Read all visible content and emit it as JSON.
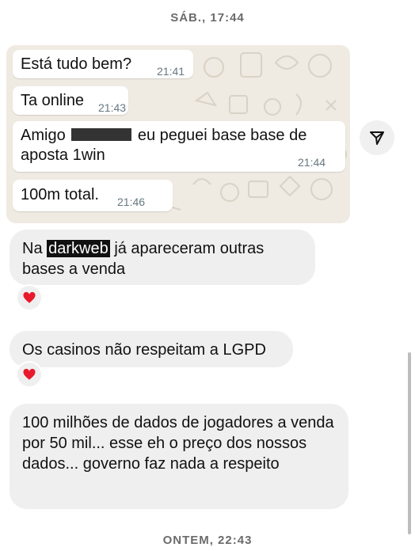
{
  "date_separators": {
    "top": "SÁB., 17:44",
    "bottom": "ONTEM, 22:43"
  },
  "shared_screenshot": {
    "messages": [
      {
        "text": "Está tudo bem?",
        "time": "21:41"
      },
      {
        "text": "Ta online",
        "time": "21:43"
      },
      {
        "text_before_redaction": "Amigo",
        "text_after_redaction": "eu peguei base base de aposta 1win",
        "time": "21:44"
      },
      {
        "text": "100m total.",
        "time": "21:46"
      }
    ]
  },
  "thread": {
    "messages": [
      {
        "prefix": "Na",
        "highlight": "darkweb",
        "suffix": "já apareceram outras bases a venda",
        "reaction": "heart-icon"
      },
      {
        "text": "Os casinos não respeitam a LGPD",
        "reaction": "heart-icon"
      },
      {
        "text": "100 milhões de dados de jogadores a venda por 50 mil... esse eh o preço dos nossos dados... governo faz nada a respeito"
      }
    ]
  },
  "icons": {
    "share": "paper-plane-icon",
    "reaction": "heart-icon"
  },
  "colors": {
    "bubble": "#efefef",
    "heart": "#e8192c",
    "chat_bg": "#efeae2"
  }
}
